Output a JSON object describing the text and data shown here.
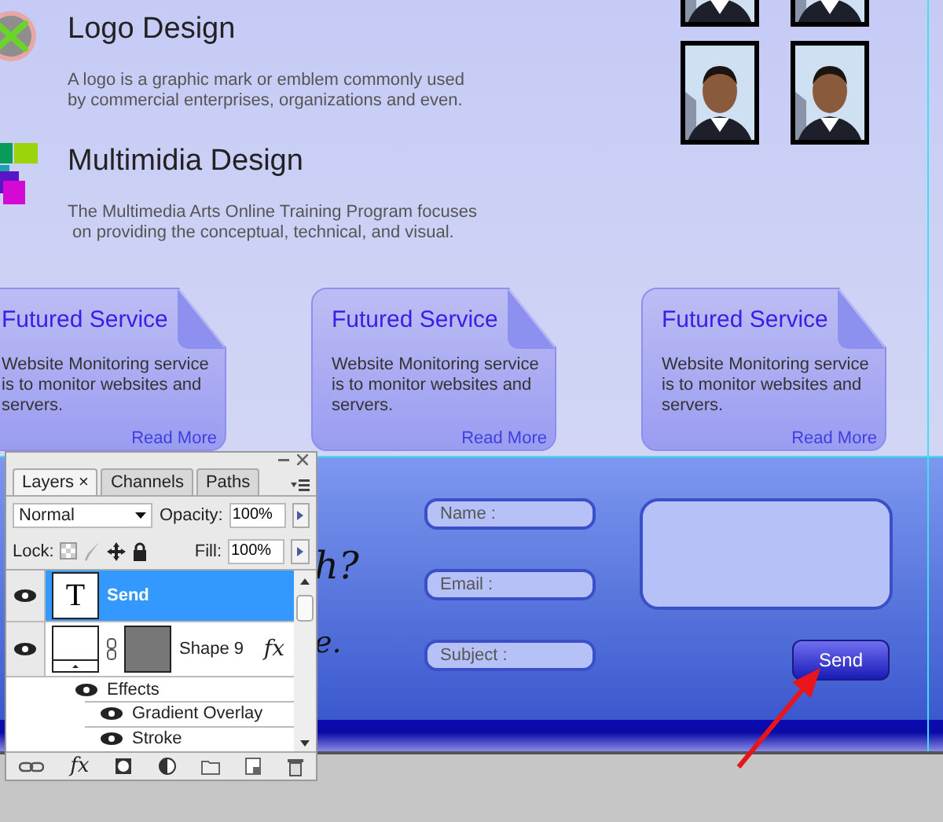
{
  "features": [
    {
      "kind": "logo",
      "title": "Logo Design",
      "description": [
        "A logo is a graphic mark or emblem commonly used",
        "by commercial enterprises, organizations and even."
      ]
    },
    {
      "kind": "multimedia",
      "title": "Multimidia Design",
      "description": [
        "The Multimedia Arts Online Training Program focuses",
        " on providing the conceptual, technical, and visual."
      ]
    }
  ],
  "cards": [
    {
      "title": "Futured Service",
      "text": [
        "Website Monitoring service",
        "is to monitor websites and",
        "servers."
      ],
      "link": "Read More"
    },
    {
      "title": "Futured Service",
      "text": [
        "Website Monitoring service",
        "is to monitor websites and",
        "servers."
      ],
      "link": "Read More"
    },
    {
      "title": "Futured Service",
      "text": [
        "Website Monitoring service",
        "is to monitor websites and",
        "servers."
      ],
      "link": "Read More"
    }
  ],
  "contact": {
    "heading_fragments": [
      "h?",
      "e."
    ],
    "fields": [
      {
        "placeholder": "Name :"
      },
      {
        "placeholder": "Email :"
      },
      {
        "placeholder": "Subject :"
      }
    ],
    "button": "Send"
  },
  "layers_panel": {
    "tabs": [
      {
        "label": "Layers",
        "close": "×",
        "selected": true
      },
      {
        "label": "Channels",
        "selected": false
      },
      {
        "label": "Paths",
        "selected": false
      }
    ],
    "blend_mode": "Normal",
    "opacity_label": "Opacity:",
    "opacity": "100%",
    "lock_label": "Lock:",
    "fill_label": "Fill:",
    "fill": "100%",
    "layers": [
      {
        "kind": "text",
        "glyph": "T",
        "name": "Send",
        "visible": true,
        "selected": true
      },
      {
        "kind": "shape",
        "name": "Shape 9",
        "visible": true,
        "selected": false,
        "fx": "fx",
        "effects_label": "Effects",
        "effects": [
          "Gradient Overlay",
          "Stroke"
        ]
      }
    ],
    "toolbar_fx": "fx"
  }
}
